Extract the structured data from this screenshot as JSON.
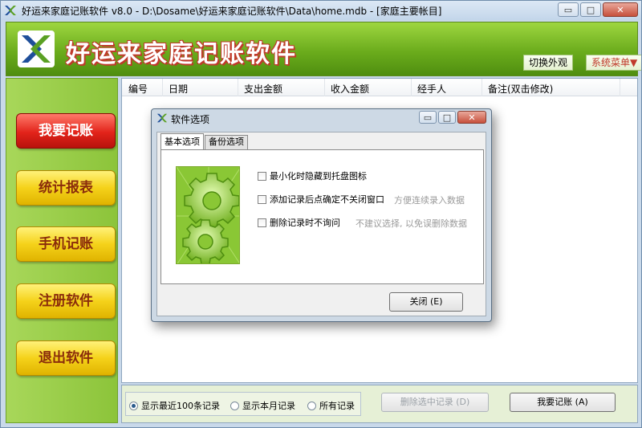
{
  "window": {
    "title": "好运来家庭记账软件 v8.0 - D:\\Dosame\\好运来家庭记账软件\\Data\\home.mdb - [家庭主要帐目]",
    "minimize_glyph": "▭",
    "maximize_glyph": "□",
    "close_glyph": "✕"
  },
  "banner": {
    "title": "好运来家庭记账软件",
    "skin_button": "切换外观",
    "menu_button": "系统菜单▼"
  },
  "sidebar": {
    "items": [
      {
        "label": "我要记账",
        "active": true
      },
      {
        "label": "统计报表"
      },
      {
        "label": "手机记账"
      },
      {
        "label": "注册软件"
      },
      {
        "label": "退出软件"
      }
    ]
  },
  "table": {
    "columns": [
      "编号",
      "日期",
      "支出金额",
      "收入金额",
      "经手人",
      "备注(双击修改)"
    ],
    "rows": []
  },
  "bottom": {
    "radios": [
      {
        "label": "显示最近100条记录",
        "checked": true
      },
      {
        "label": "显示本月记录",
        "checked": false
      },
      {
        "label": "所有记录",
        "checked": false
      }
    ],
    "delete_button": "删除选中记录 (D)",
    "record_button": "我要记账 (A)"
  },
  "dialog": {
    "title": "软件选项",
    "tabs": [
      "基本选项",
      "备份选项"
    ],
    "options": [
      {
        "label": "最小化时隐藏到托盘图标",
        "checked": false,
        "hint": ""
      },
      {
        "label": "添加记录后点确定不关闭窗口",
        "checked": false,
        "hint": "方便连续录入数据"
      },
      {
        "label": "删除记录时不询问",
        "checked": false,
        "hint": "不建议选择, 以免误删除数据"
      }
    ],
    "close_button": "关闭 (E)"
  },
  "colors": {
    "banner_green": "#6bac1c",
    "sidebar_green": "#8cc43a",
    "button_yellow": "#f5d21a",
    "button_red": "#e2231a"
  }
}
